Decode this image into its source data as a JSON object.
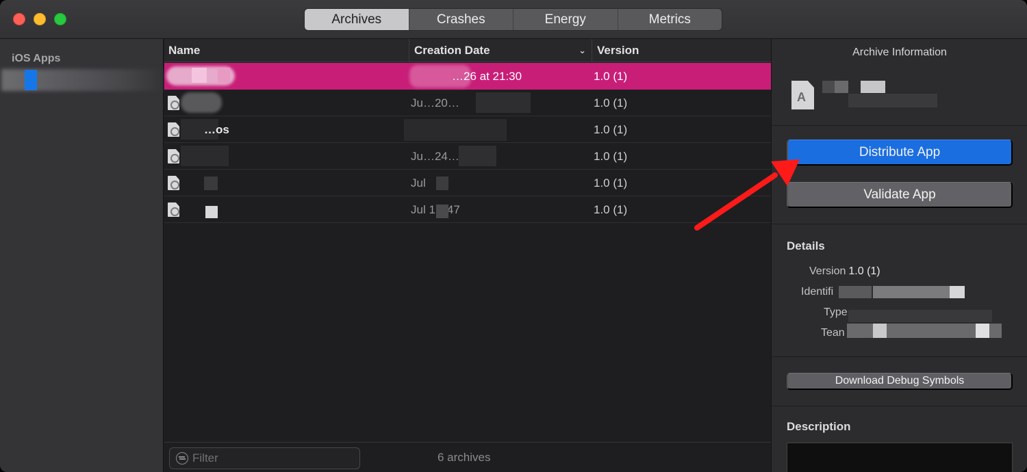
{
  "tabs": [
    {
      "label": "Archives",
      "active": true
    },
    {
      "label": "Crashes",
      "active": false
    },
    {
      "label": "Energy",
      "active": false
    },
    {
      "label": "Metrics",
      "active": false
    }
  ],
  "sidebar": {
    "heading": "iOS Apps"
  },
  "table": {
    "columns": {
      "name": "Name",
      "date": "Creation Date",
      "version": "Version"
    },
    "rows": [
      {
        "name": "",
        "date": "…26 at 21:30",
        "version": "1.0 (1)",
        "selected": true
      },
      {
        "name": "",
        "date": "Ju…20…",
        "version": "1.0 (1)"
      },
      {
        "name": "…os",
        "date": "",
        "version": "1.0 (1)"
      },
      {
        "name": "",
        "date": "Ju…24…:01",
        "version": "1.0 (1)"
      },
      {
        "name": "",
        "date": "Jul",
        "version": "1.0 (1)"
      },
      {
        "name": "",
        "date": "Jul 1…47",
        "version": "1.0 (1)"
      }
    ]
  },
  "footer": {
    "filter_placeholder": "Filter",
    "count": "6 archives"
  },
  "panel": {
    "title": "Archive Information",
    "distribute_label": "Distribute App",
    "validate_label": "Validate App",
    "details_heading": "Details",
    "details": [
      {
        "key": "Version",
        "value": "1.0 (1)"
      },
      {
        "key": "Identifi",
        "value": ""
      },
      {
        "key": "Type",
        "value": ""
      },
      {
        "key": "Tean",
        "value": ""
      }
    ],
    "debug_symbols_label": "Download Debug Symbols",
    "description_heading": "Description"
  },
  "colors": {
    "accent": "#1b6ee0",
    "selection": "#c81e78",
    "annotation_arrow": "#ff1a1a"
  }
}
